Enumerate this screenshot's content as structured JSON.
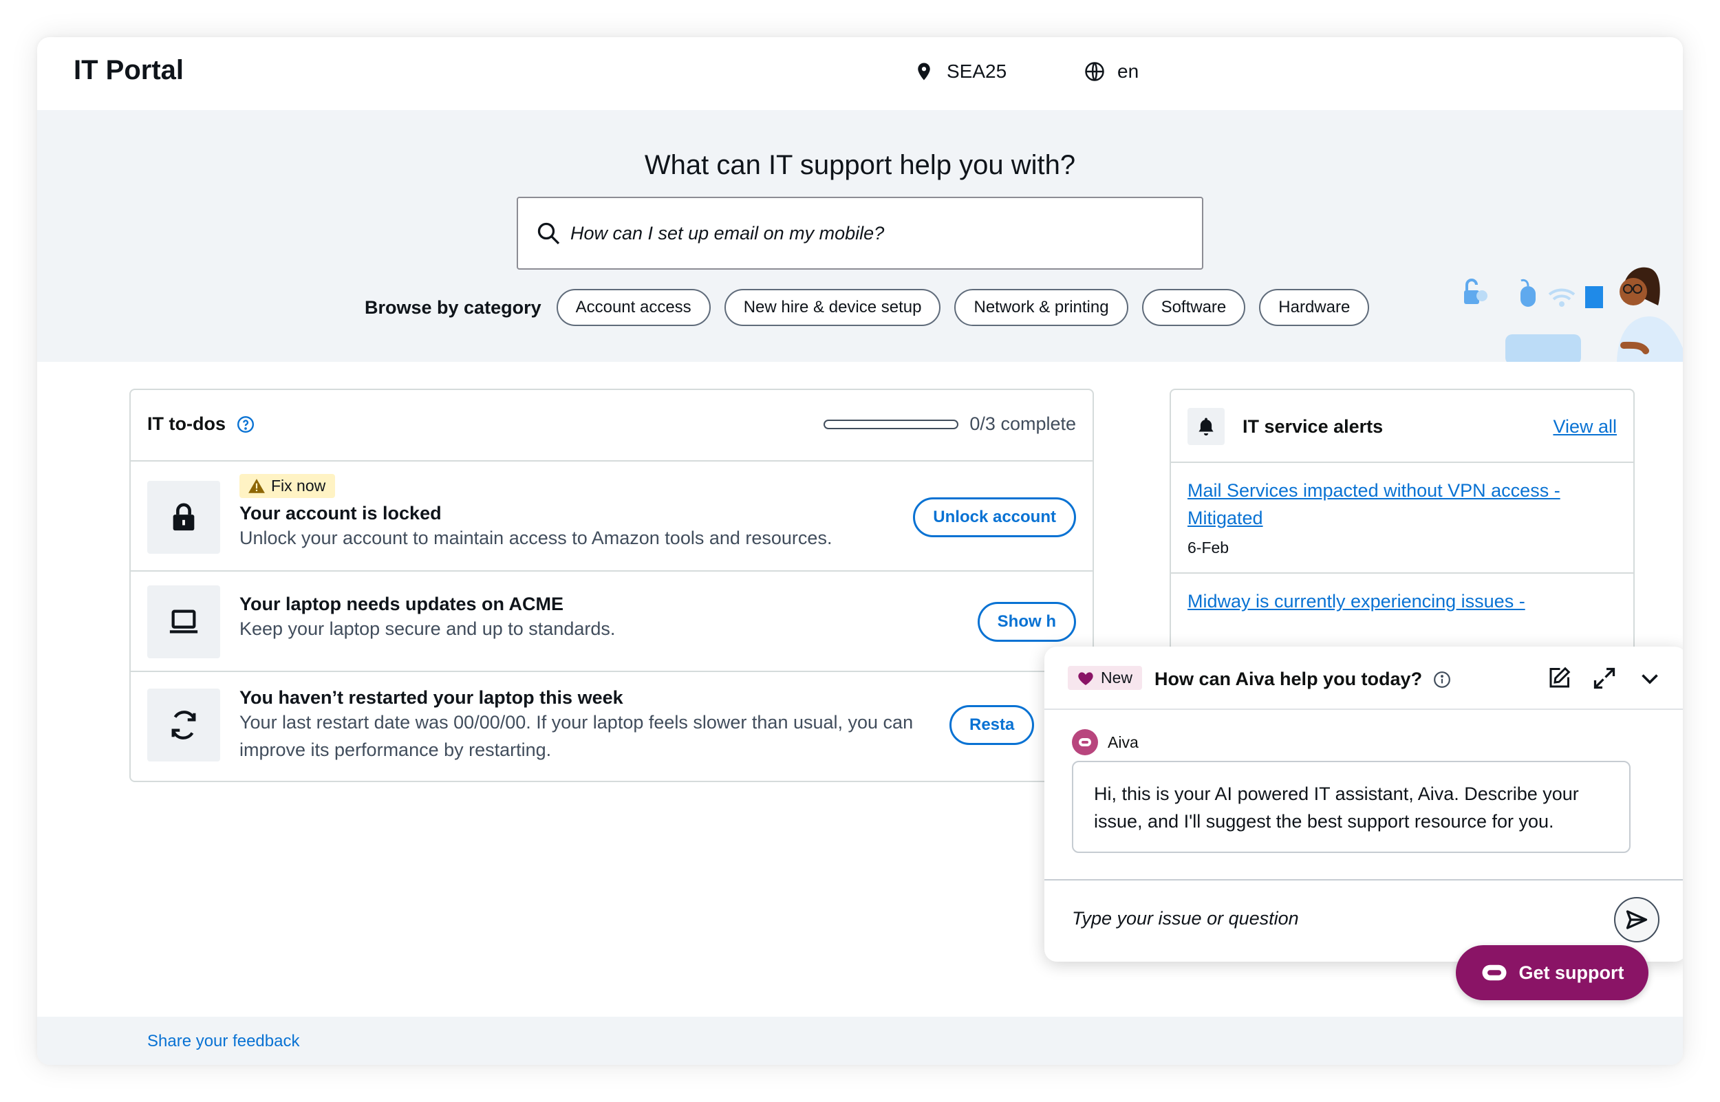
{
  "app": {
    "title": "IT Portal",
    "location": "SEA25",
    "language": "en"
  },
  "hero": {
    "title": "What can IT support help you with?",
    "search_placeholder": "How can I set up email on my mobile?",
    "browse_label": "Browse by category",
    "categories": [
      "Account access",
      "New hire & device setup",
      "Network & printing",
      "Software",
      "Hardware"
    ]
  },
  "todos": {
    "title": "IT to-dos",
    "progress_text": "0/3 complete",
    "progress_fraction": 0,
    "items": [
      {
        "badge": "Fix now",
        "title": "Your account is locked",
        "desc": "Unlock your account to maintain access to Amazon tools and resources.",
        "action": "Unlock account",
        "icon": "lock-icon"
      },
      {
        "title": "Your laptop needs updates on ACME",
        "desc": "Keep your laptop secure and up to standards.",
        "action": "Show h",
        "icon": "laptop-icon"
      },
      {
        "title": "You haven’t restarted your laptop this week",
        "desc_1": "Your last restart date was 00/00/00. If your laptop feels slower than usual, you can",
        "desc_2": "improve its performance by restarting.",
        "action": "Resta",
        "icon": "refresh-icon"
      }
    ]
  },
  "alerts": {
    "title": "IT service alerts",
    "view_all": "View all",
    "items": [
      {
        "line_1": "Mail Services impacted without VPN access -",
        "line_2": "Mitigated",
        "date": "6-Feb"
      },
      {
        "line_1": "Midway is currently experiencing issues -"
      }
    ]
  },
  "chat": {
    "badge": "New",
    "title": "How can Aiva help you today?",
    "bot_name": "Aiva",
    "message": "Hi, this is your AI powered IT assistant, Aiva. Describe your issue, and I'll suggest the best support resource for you.",
    "input_placeholder": "Type your issue or question"
  },
  "get_support": "Get support",
  "footer": {
    "feedback": "Share your feedback"
  },
  "colors": {
    "accent": "#0972d3",
    "brand": "#8a1466",
    "hero_bg": "#f1f4f7",
    "warning_bg": "#fff3c4"
  }
}
